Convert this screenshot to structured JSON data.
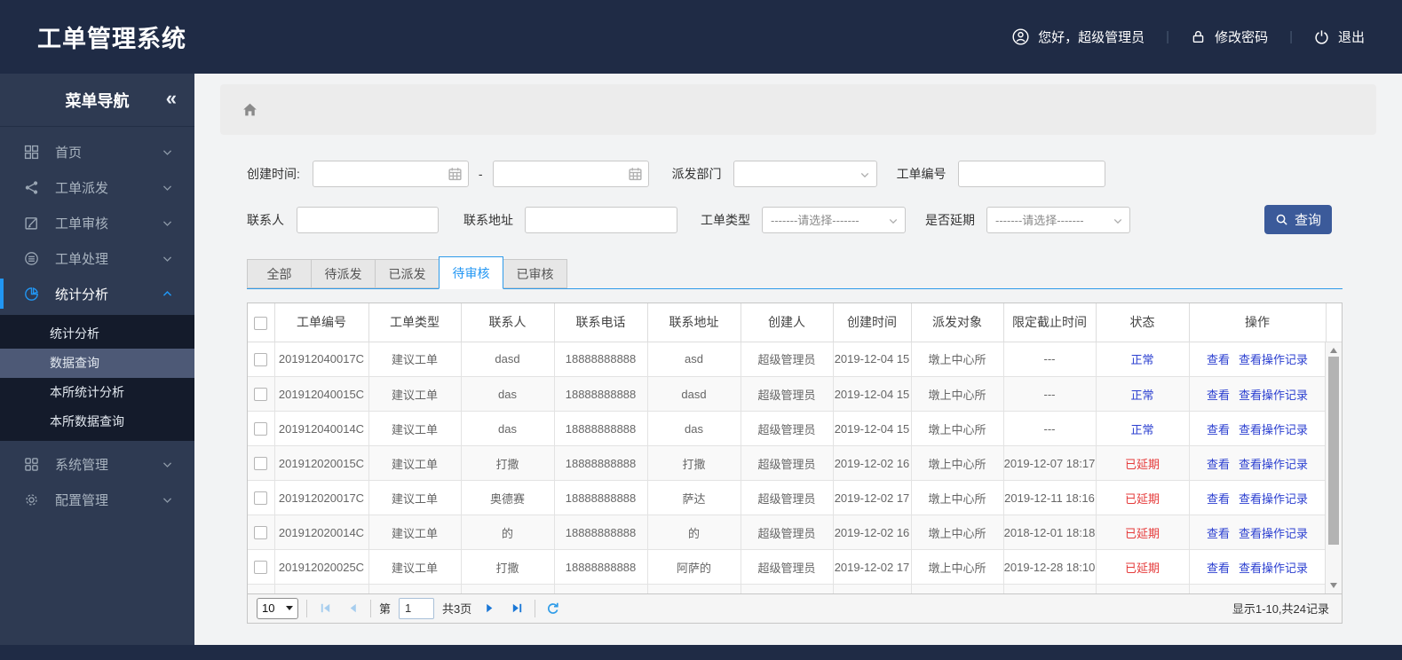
{
  "header": {
    "title": "工单管理系统",
    "greeting": "您好，超级管理员",
    "change_password": "修改密码",
    "logout": "退出"
  },
  "sidebar": {
    "title": "菜单导航",
    "collapse_icon": "«",
    "items": [
      {
        "label": "首页"
      },
      {
        "label": "工单派发"
      },
      {
        "label": "工单审核"
      },
      {
        "label": "工单处理"
      },
      {
        "label": "统计分析",
        "active": true
      },
      {
        "label": "系统管理"
      },
      {
        "label": "配置管理"
      }
    ],
    "submenu": [
      {
        "label": "统计分析",
        "selected": false
      },
      {
        "label": "数据查询",
        "selected": true
      },
      {
        "label": "本所统计分析",
        "selected": false
      },
      {
        "label": "本所数据查询",
        "selected": false
      }
    ]
  },
  "filters": {
    "create_time_label": "创建时间:",
    "create_time_from": "",
    "create_time_to": "",
    "range_separator": "-",
    "dispatch_dept_label": "派发部门",
    "dispatch_dept_value": "",
    "order_no_label": "工单编号",
    "order_no_value": "",
    "contact_label": "联系人",
    "contact_value": "",
    "address_label": "联系地址",
    "address_value": "",
    "order_type_label": "工单类型",
    "order_type_value": "-------请选择-------",
    "delay_label": "是否延期",
    "delay_value": "-------请选择-------",
    "search_button": "查询"
  },
  "tabs": [
    {
      "label": "全部",
      "active": false
    },
    {
      "label": "待派发",
      "active": false
    },
    {
      "label": "已派发",
      "active": false
    },
    {
      "label": "待审核",
      "active": true
    },
    {
      "label": "已审核",
      "active": false
    }
  ],
  "table": {
    "columns": [
      "工单编号",
      "工单类型",
      "联系人",
      "联系电话",
      "联系地址",
      "创建人",
      "创建时间",
      "派发对象",
      "限定截止时间",
      "状态",
      "操作"
    ],
    "actions": [
      "查看",
      "查看操作记录"
    ],
    "rows": [
      {
        "cells": [
          "201912040017C",
          "建议工单",
          "dasd",
          "18888888888",
          "asd",
          "超级管理员",
          "2019-12-04 15",
          "墩上中心所",
          "---"
        ],
        "status": "正常",
        "state": "normal"
      },
      {
        "cells": [
          "201912040015C",
          "建议工单",
          "das",
          "18888888888",
          "dasd",
          "超级管理员",
          "2019-12-04 15",
          "墩上中心所",
          "---"
        ],
        "status": "正常",
        "state": "normal"
      },
      {
        "cells": [
          "201912040014C",
          "建议工单",
          "das",
          "18888888888",
          "das",
          "超级管理员",
          "2019-12-04 15",
          "墩上中心所",
          "---"
        ],
        "status": "正常",
        "state": "normal"
      },
      {
        "cells": [
          "201912020015C",
          "建议工单",
          "打撒",
          "18888888888",
          "打撒",
          "超级管理员",
          "2019-12-02 16",
          "墩上中心所",
          "2019-12-07 18:17"
        ],
        "status": "已延期",
        "state": "delayed"
      },
      {
        "cells": [
          "201912020017C",
          "建议工单",
          "奥德赛",
          "18888888888",
          "萨达",
          "超级管理员",
          "2019-12-02 17",
          "墩上中心所",
          "2019-12-11 18:16"
        ],
        "status": "已延期",
        "state": "delayed"
      },
      {
        "cells": [
          "201912020014C",
          "建议工单",
          "的",
          "18888888888",
          "的",
          "超级管理员",
          "2019-12-02 16",
          "墩上中心所",
          "2018-12-01 18:18"
        ],
        "status": "已延期",
        "state": "delayed"
      },
      {
        "cells": [
          "201912020025C",
          "建议工单",
          "打撒",
          "18888888888",
          "阿萨的",
          "超级管理员",
          "2019-12-02 17",
          "墩上中心所",
          "2019-12-28 18:10"
        ],
        "status": "已延期",
        "state": "delayed"
      },
      {
        "cells": [
          "",
          "",
          "",
          "",
          "",
          "",
          "",
          "",
          ""
        ],
        "status": "",
        "state": "partial"
      }
    ]
  },
  "pagination": {
    "page_size": "10",
    "page_prefix": "第",
    "current_page": "1",
    "total_pages": "共3页",
    "summary": "显示1-10,共24记录"
  },
  "colors": {
    "accent": "#2196f3",
    "header-bg": "#1f2b45",
    "sidebar-bg": "#2e3a52",
    "submenu-bg": "#141b2b",
    "submenu-selected-bg": "#4d5976",
    "button-bg": "#3b5a9a",
    "link-blue": "#2b3fd0",
    "status-normal": "#2b3fd0",
    "status-delayed": "#e53b3b"
  }
}
